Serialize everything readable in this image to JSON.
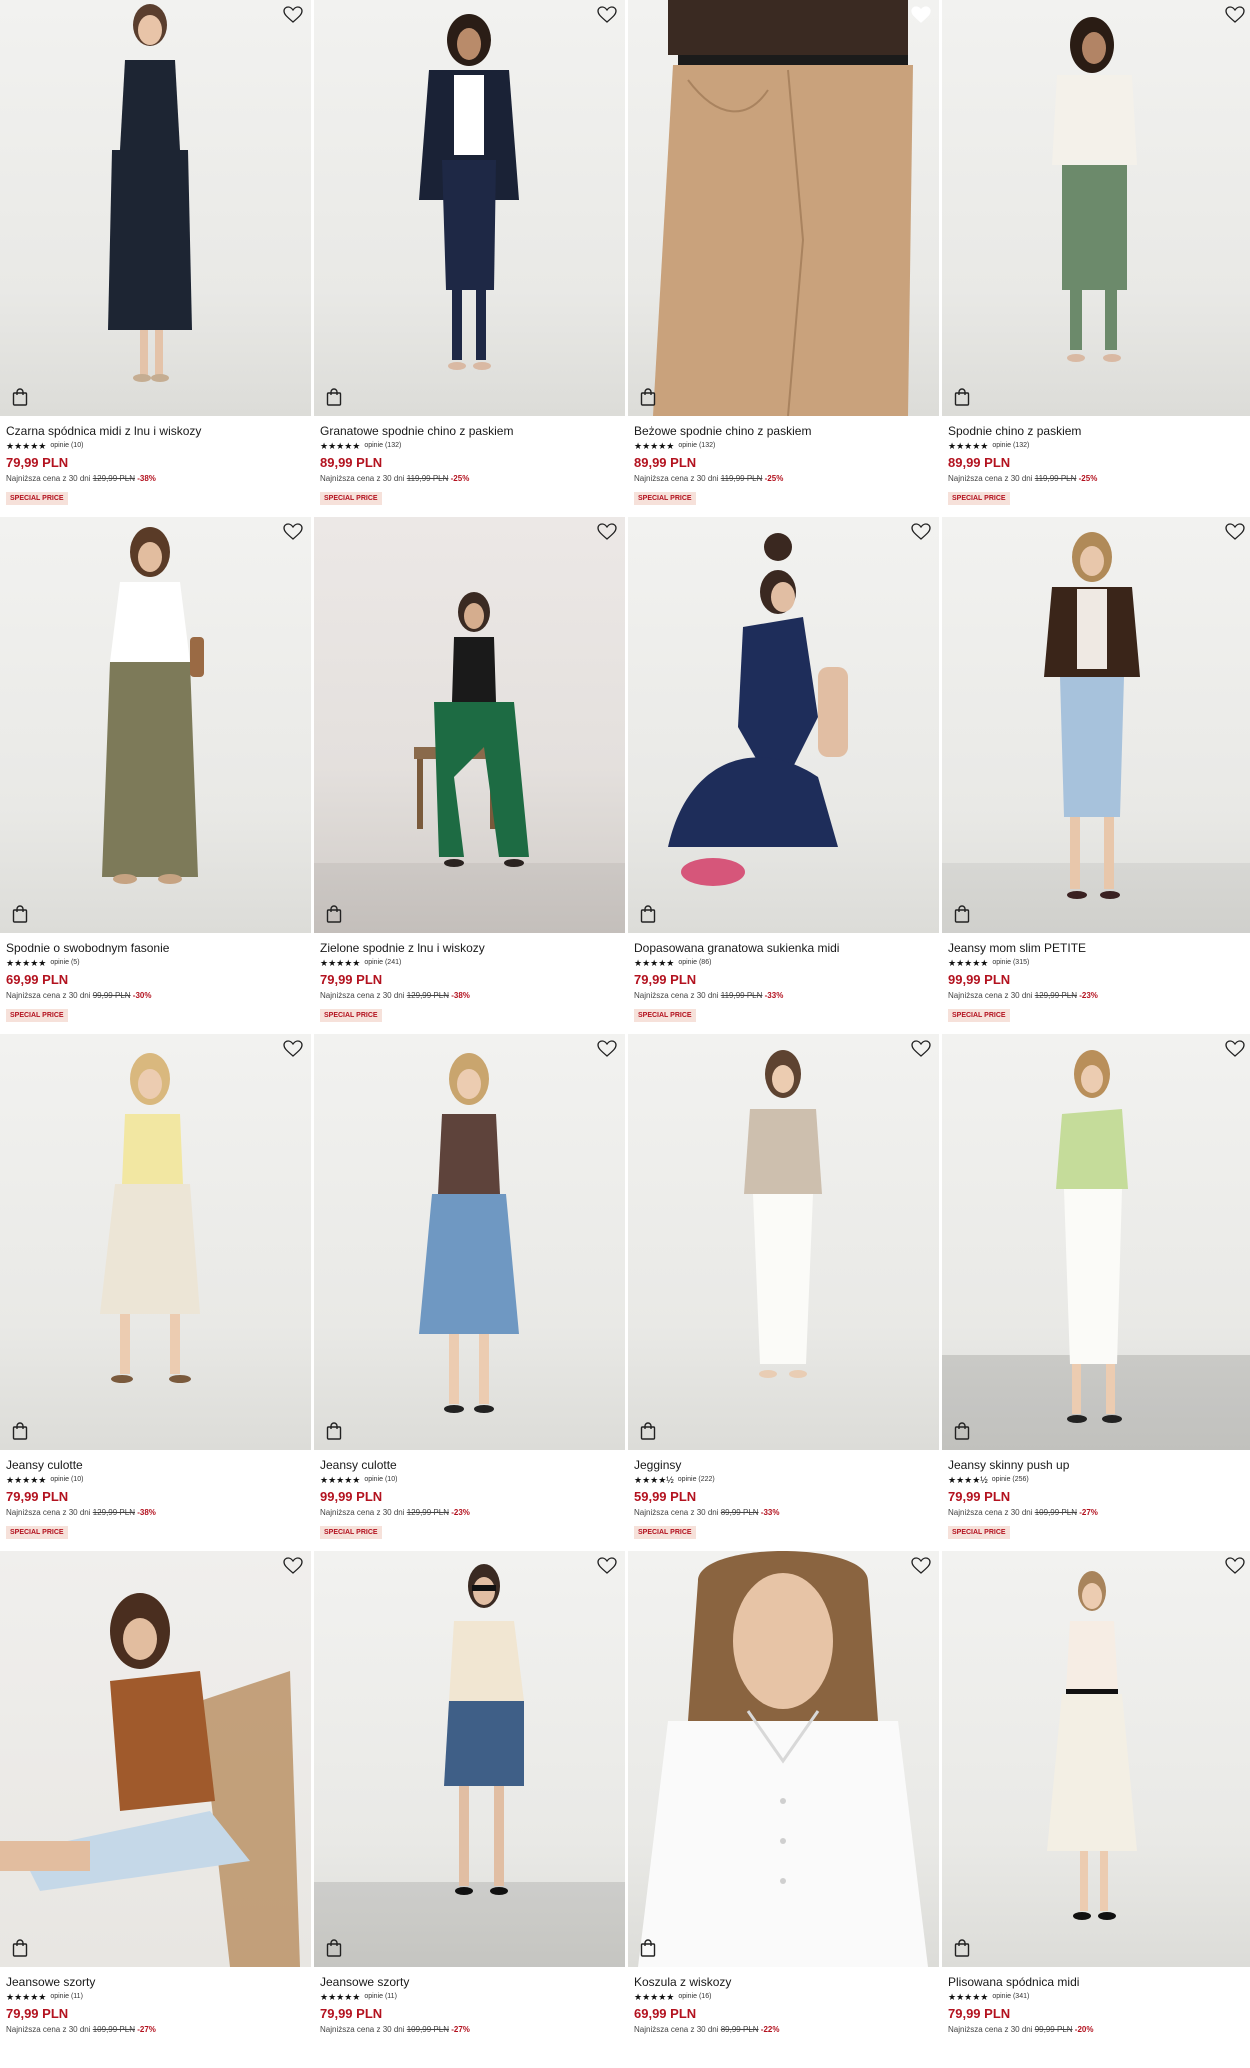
{
  "colors": {
    "price_red": "#b3121f",
    "badge_bg": "#f6e1da"
  },
  "icons": {
    "wishlist": "heart-icon",
    "cart": "shopping-bag-icon",
    "rating": "star-icon"
  },
  "products": [
    {
      "name": "Czarna spódnica midi z lnu i wiskozy",
      "stars": "★★★★★",
      "reviews": "opinie (10)",
      "price": "79,99 PLN",
      "lowest_prefix": "Najniższa cena z 30 dni",
      "old_price": "129,99 PLN",
      "discount": "-38%",
      "badge": "SPECIAL PRICE"
    },
    {
      "name": "Granatowe spodnie chino z paskiem",
      "stars": "★★★★★",
      "reviews": "opinie (132)",
      "price": "89,99 PLN",
      "lowest_prefix": "Najniższa cena z 30 dni",
      "old_price": "119,99 PLN",
      "discount": "-25%",
      "badge": "SPECIAL PRICE"
    },
    {
      "name": "Beżowe spodnie chino z paskiem",
      "stars": "★★★★★",
      "reviews": "opinie (132)",
      "price": "89,99 PLN",
      "lowest_prefix": "Najniższa cena z 30 dni",
      "old_price": "119,99 PLN",
      "discount": "-25%",
      "badge": "SPECIAL PRICE"
    },
    {
      "name": "Spodnie chino z paskiem",
      "stars": "★★★★★",
      "reviews": "opinie (132)",
      "price": "89,99 PLN",
      "lowest_prefix": "Najniższa cena z 30 dni",
      "old_price": "119,99 PLN",
      "discount": "-25%",
      "badge": "SPECIAL PRICE"
    },
    {
      "name": "Spodnie o swobodnym fasonie",
      "stars": "★★★★★",
      "reviews": "opinie (5)",
      "price": "69,99 PLN",
      "lowest_prefix": "Najniższa cena z 30 dni",
      "old_price": "99,99 PLN",
      "discount": "-30%",
      "badge": "SPECIAL PRICE"
    },
    {
      "name": "Zielone spodnie z lnu i wiskozy",
      "stars": "★★★★★",
      "reviews": "opinie (241)",
      "price": "79,99 PLN",
      "lowest_prefix": "Najniższa cena z 30 dni",
      "old_price": "129,99 PLN",
      "discount": "-38%",
      "badge": "SPECIAL PRICE"
    },
    {
      "name": "Dopasowana granatowa sukienka midi",
      "stars": "★★★★★",
      "reviews": "opinie (86)",
      "price": "79,99 PLN",
      "lowest_prefix": "Najniższa cena z 30 dni",
      "old_price": "119,99 PLN",
      "discount": "-33%",
      "badge": "SPECIAL PRICE"
    },
    {
      "name": "Jeansy mom slim PETITE",
      "stars": "★★★★★",
      "reviews": "opinie (315)",
      "price": "99,99 PLN",
      "lowest_prefix": "Najniższa cena z 30 dni",
      "old_price": "129,99 PLN",
      "discount": "-23%",
      "badge": "SPECIAL PRICE"
    },
    {
      "name": "Jeansy culotte",
      "stars": "★★★★★",
      "reviews": "opinie (10)",
      "price": "79,99 PLN",
      "lowest_prefix": "Najniższa cena z 30 dni",
      "old_price": "129,99 PLN",
      "discount": "-38%",
      "badge": "SPECIAL PRICE"
    },
    {
      "name": "Jeansy culotte",
      "stars": "★★★★★",
      "reviews": "opinie (10)",
      "price": "99,99 PLN",
      "lowest_prefix": "Najniższa cena z 30 dni",
      "old_price": "129,99 PLN",
      "discount": "-23%",
      "badge": "SPECIAL PRICE"
    },
    {
      "name": "Jegginsy",
      "stars": "★★★★½",
      "reviews": "opinie (222)",
      "price": "59,99 PLN",
      "lowest_prefix": "Najniższa cena z 30 dni",
      "old_price": "89,99 PLN",
      "discount": "-33%",
      "badge": "SPECIAL PRICE"
    },
    {
      "name": "Jeansy skinny push up",
      "stars": "★★★★½",
      "reviews": "opinie (256)",
      "price": "79,99 PLN",
      "lowest_prefix": "Najniższa cena z 30 dni",
      "old_price": "109,99 PLN",
      "discount": "-27%",
      "badge": "SPECIAL PRICE"
    },
    {
      "name": "Jeansowe szorty",
      "stars": "★★★★★",
      "reviews": "opinie (11)",
      "price": "79,99 PLN",
      "lowest_prefix": "Najniższa cena z 30 dni",
      "old_price": "109,99 PLN",
      "discount": "-27%",
      "badge": ""
    },
    {
      "name": "Jeansowe szorty",
      "stars": "★★★★★",
      "reviews": "opinie (11)",
      "price": "79,99 PLN",
      "lowest_prefix": "Najniższa cena z 30 dni",
      "old_price": "109,99 PLN",
      "discount": "-27%",
      "badge": ""
    },
    {
      "name": "Koszula z wiskozy",
      "stars": "★★★★★",
      "reviews": "opinie (16)",
      "price": "69,99 PLN",
      "lowest_prefix": "Najniższa cena z 30 dni",
      "old_price": "89,99 PLN",
      "discount": "-22%",
      "badge": ""
    },
    {
      "name": "Plisowana spódnica midi",
      "stars": "★★★★★",
      "reviews": "opinie (341)",
      "price": "79,99 PLN",
      "lowest_prefix": "Najniższa cena z 30 dni",
      "old_price": "99,99 PLN",
      "discount": "-20%",
      "badge": ""
    }
  ]
}
